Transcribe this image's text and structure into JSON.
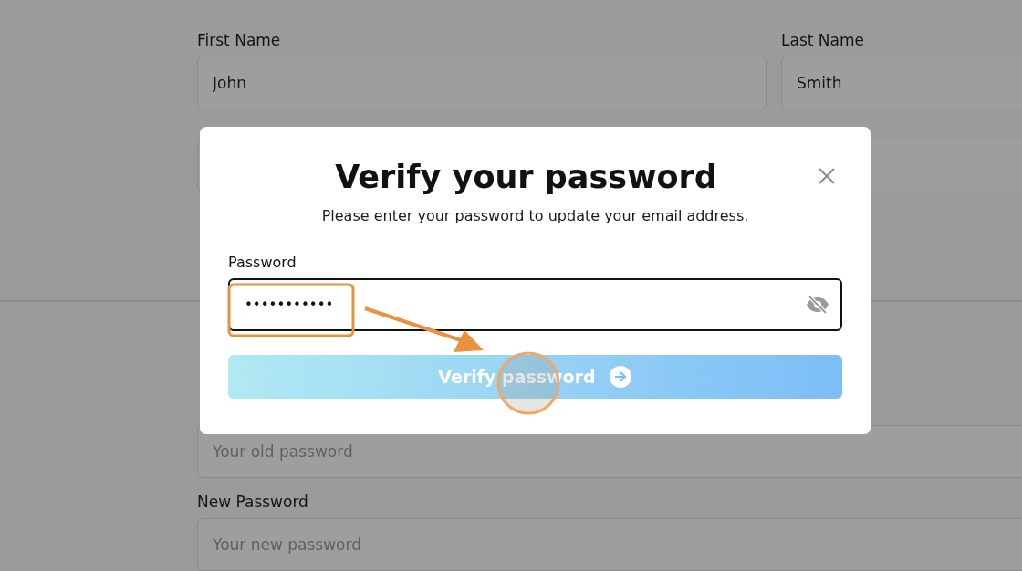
{
  "form": {
    "name_fields": [
      {
        "label": "First Name",
        "value": "John"
      },
      {
        "label": "Last Name",
        "value": "Smith"
      }
    ],
    "password_fields": [
      {
        "placeholder": "Your old password"
      },
      {
        "label": "New Password",
        "placeholder": "Your new password"
      }
    ]
  },
  "dialog": {
    "title": "Verify your password",
    "subtitle": "Please enter your password to update your email address.",
    "field": {
      "label": "Password",
      "value": "•••••••••••"
    },
    "button": {
      "label": "Verify password"
    }
  }
}
